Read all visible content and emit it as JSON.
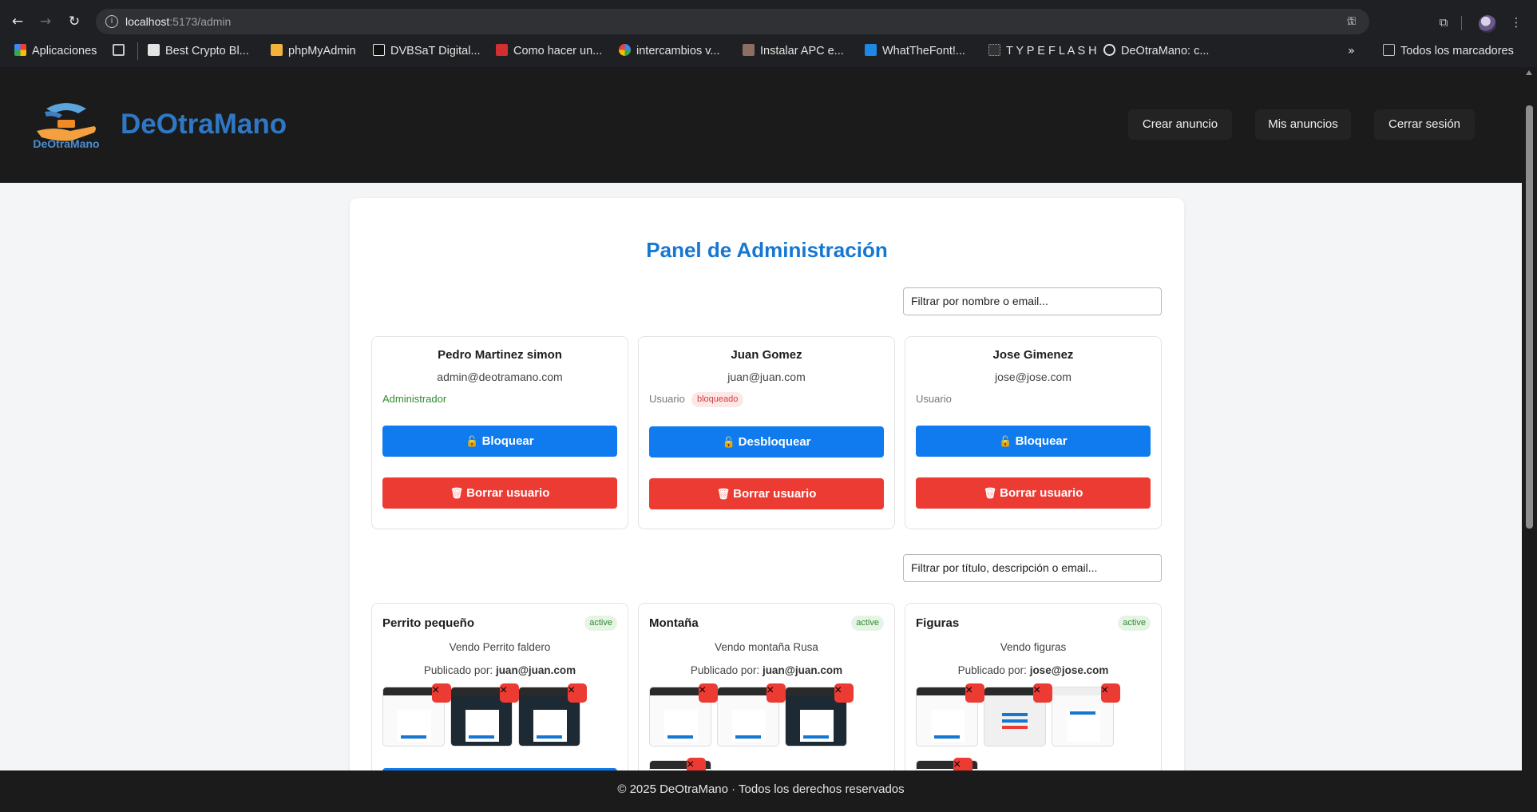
{
  "browser": {
    "url_host": "localhost",
    "url_path": ":5173/admin",
    "bookmarks": [
      {
        "label": "Aplicaciones",
        "icon": "apps-grid-icon"
      },
      {
        "label": "Best Crypto Bl...",
        "icon": "crypto-favicon"
      },
      {
        "label": "phpMyAdmin",
        "icon": "phpmyadmin-favicon"
      },
      {
        "label": "DVBSaT Digital...",
        "icon": "dvbsat-favicon"
      },
      {
        "label": "Como hacer un...",
        "icon": "wt-favicon"
      },
      {
        "label": "intercambios v...",
        "icon": "google-favicon"
      },
      {
        "label": "Instalar APC e...",
        "icon": "apc-favicon"
      },
      {
        "label": "WhatTheFont!...",
        "icon": "whatthefont-favicon"
      },
      {
        "label": "T Y P E F L A S H",
        "icon": "typeflash-favicon"
      },
      {
        "label": "DeOtraMano: c...",
        "icon": "globe-favicon"
      }
    ],
    "all_bookmarks_label": "Todos los marcadores"
  },
  "header": {
    "logo_text": "DeOtraMano",
    "brand": "DeOtraMano",
    "nav": [
      "Crear anuncio",
      "Mis anuncios",
      "Cerrar sesión"
    ]
  },
  "main": {
    "title": "Panel de Administración",
    "user_filter_placeholder": "Filtrar por nombre o email...",
    "ad_filter_placeholder": "Filtrar por título, descripción o email...",
    "users": [
      {
        "name": "Pedro Martinez simon",
        "email": "admin@deotramano.com",
        "role": "Administrador",
        "badge": "",
        "action": "Bloquear",
        "delete": "Borrar usuario"
      },
      {
        "name": "Juan Gomez",
        "email": "juan@juan.com",
        "role": "Usuario",
        "badge": "bloqueado",
        "action": "Desbloquear",
        "delete": "Borrar usuario"
      },
      {
        "name": "Jose Gimenez",
        "email": "jose@jose.com",
        "role": "Usuario",
        "badge": "",
        "action": "Bloquear",
        "delete": "Borrar usuario"
      }
    ],
    "ads": [
      {
        "title": "Perrito pequeño",
        "status": "active",
        "description": "Vendo Perrito faldero",
        "published_prefix": "Publicado por:",
        "email": "juan@juan.com"
      },
      {
        "title": "Montaña",
        "status": "active",
        "description": "Vendo montaña Rusa",
        "published_prefix": "Publicado por:",
        "email": "juan@juan.com"
      },
      {
        "title": "Figuras",
        "status": "active",
        "description": "Vendo figuras",
        "published_prefix": "Publicado por:",
        "email": "jose@jose.com"
      }
    ],
    "lock_glyph": "🔓",
    "trash_glyph": "🗑",
    "remove_glyph": "×"
  },
  "footer": {
    "text": "© 2025 DeOtraMano · Todos los derechos reservados"
  },
  "colors": {
    "accent": "#1677d2",
    "primary_button": "#0f7bef",
    "danger_button": "#ec3b33",
    "header_bg": "#1b1b1b"
  }
}
